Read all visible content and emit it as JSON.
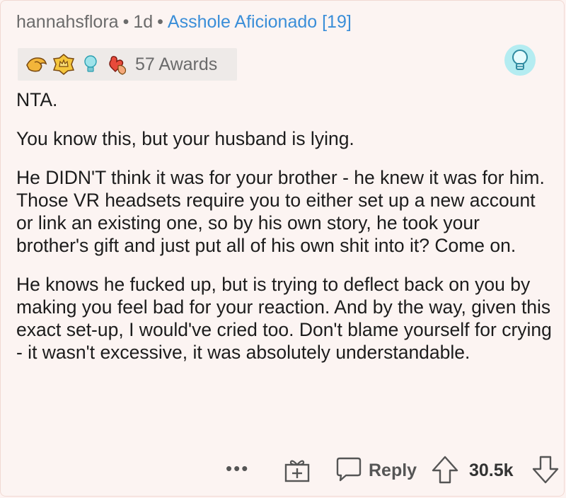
{
  "comment": {
    "username": "hannahsflora",
    "age": "1d",
    "flair": "Asshole Aficionado [19]",
    "awards_label": "57 Awards",
    "award_icons": [
      "hand-award-icon",
      "crown-award-icon",
      "bulb-award-icon",
      "heart-hands-award-icon"
    ],
    "badge_icon": "bulb-badge-icon",
    "paragraphs": [
      "NTA.",
      "You know this, but your husband is lying.",
      "He DIDN'T think it was for your brother - he knew it was for him. Those VR headsets require you to either set up a new account or link an existing one, so by his own story, he took your brother's gift and just put all of his own shit into it? Come on.",
      "He knows he fucked up, but is trying to deflect back on you by making you feel bad for your reaction. And by the way, given this exact set-up, I would've cried too. Don't blame yourself for crying - it wasn't excessive, it was absolutely understandable."
    ]
  },
  "actions": {
    "more": "•••",
    "reply_label": "Reply",
    "score": "30.5k"
  },
  "colors": {
    "flair": "#3a8ed8",
    "background": "#fcf4f2",
    "muted": "#6b6b6b"
  }
}
